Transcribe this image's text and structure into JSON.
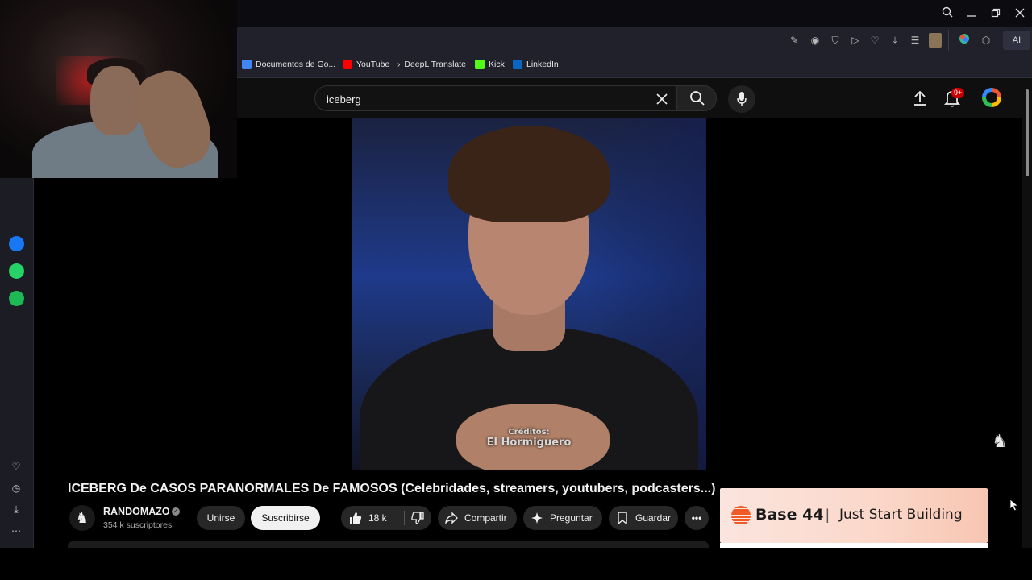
{
  "bookmarks": [
    {
      "label": "Documentos de Go...",
      "icon": "google-docs-icon",
      "color": "#4285f4"
    },
    {
      "label": "YouTube",
      "icon": "youtube-icon",
      "color": "#ff0000"
    },
    {
      "label": "DeepL Translate",
      "icon": "deepl-icon",
      "color": "#e6e6e6"
    },
    {
      "label": "Kick",
      "icon": "kick-icon",
      "color": "#53fc18"
    },
    {
      "label": "LinkedIn",
      "icon": "linkedin-icon",
      "color": "#0a66c2"
    }
  ],
  "toolbar": {
    "ai_label": "AI"
  },
  "search": {
    "value": "iceberg"
  },
  "notifications": {
    "badge": "9+"
  },
  "video": {
    "overlay_line1": "Créditos:",
    "overlay_line2": "El Hormiguero",
    "title": "ICEBERG De CASOS PARANORMALES De FAMOSOS (Celebridades, streamers, youtubers, podcasters...)"
  },
  "channel": {
    "name": "RANDOMAZO",
    "subscribers": "354 k suscriptores"
  },
  "actions": {
    "join": "Unirse",
    "subscribe": "Suscribirse",
    "likes": "18 k",
    "share": "Compartir",
    "ask": "Preguntar",
    "save": "Guardar"
  },
  "ad": {
    "brand": "Base 44",
    "separator": "|",
    "tagline": "Just Start Building"
  },
  "colors": {
    "background": "#000000",
    "youtube_header": "#0f0f0f",
    "browser_toolbar": "#20212b",
    "pill": "#272727",
    "subscribe": "#f1f1f1",
    "notification_badge": "#cc0000"
  }
}
